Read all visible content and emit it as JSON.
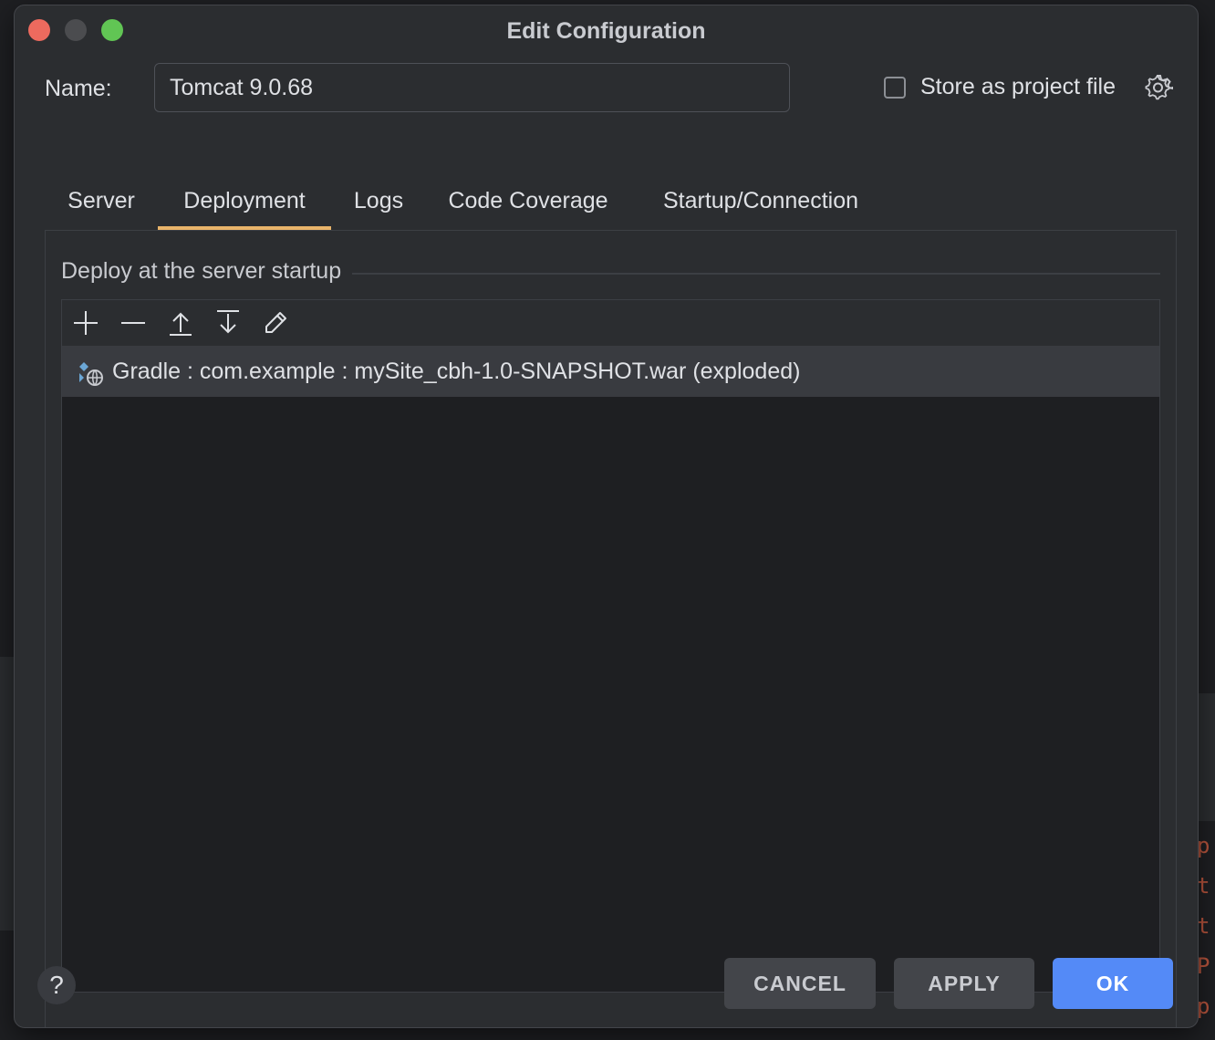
{
  "window": {
    "title": "Edit Configuration"
  },
  "name_field": {
    "label": "Name:",
    "value": "Tomcat 9.0.68"
  },
  "store_option": {
    "label": "Store as project file",
    "checked": false
  },
  "tabs": [
    {
      "label": "Server",
      "active": false
    },
    {
      "label": "Deployment",
      "active": true
    },
    {
      "label": "Logs",
      "active": false
    },
    {
      "label": "Code Coverage",
      "active": false
    },
    {
      "label": "Startup/Connection",
      "active": false
    }
  ],
  "deployment": {
    "group_title": "Deploy at the server startup",
    "toolbar_icons": [
      "add-icon",
      "remove-icon",
      "move-up-icon",
      "move-down-icon",
      "edit-icon"
    ],
    "artifacts": [
      {
        "label": "Gradle : com.example : mySite_cbh-1.0-SNAPSHOT.war (exploded)",
        "icon": "artifact-web-icon"
      }
    ]
  },
  "buttons": {
    "help": "?",
    "cancel": "CANCEL",
    "apply": "APPLY",
    "ok": "OK"
  },
  "background": {
    "code_chars": [
      "p",
      "t",
      "t",
      "P",
      "p"
    ]
  },
  "colors": {
    "accent_tab": "#e9b46a",
    "primary_button": "#548af7",
    "dialog_bg": "#2b2d30"
  }
}
